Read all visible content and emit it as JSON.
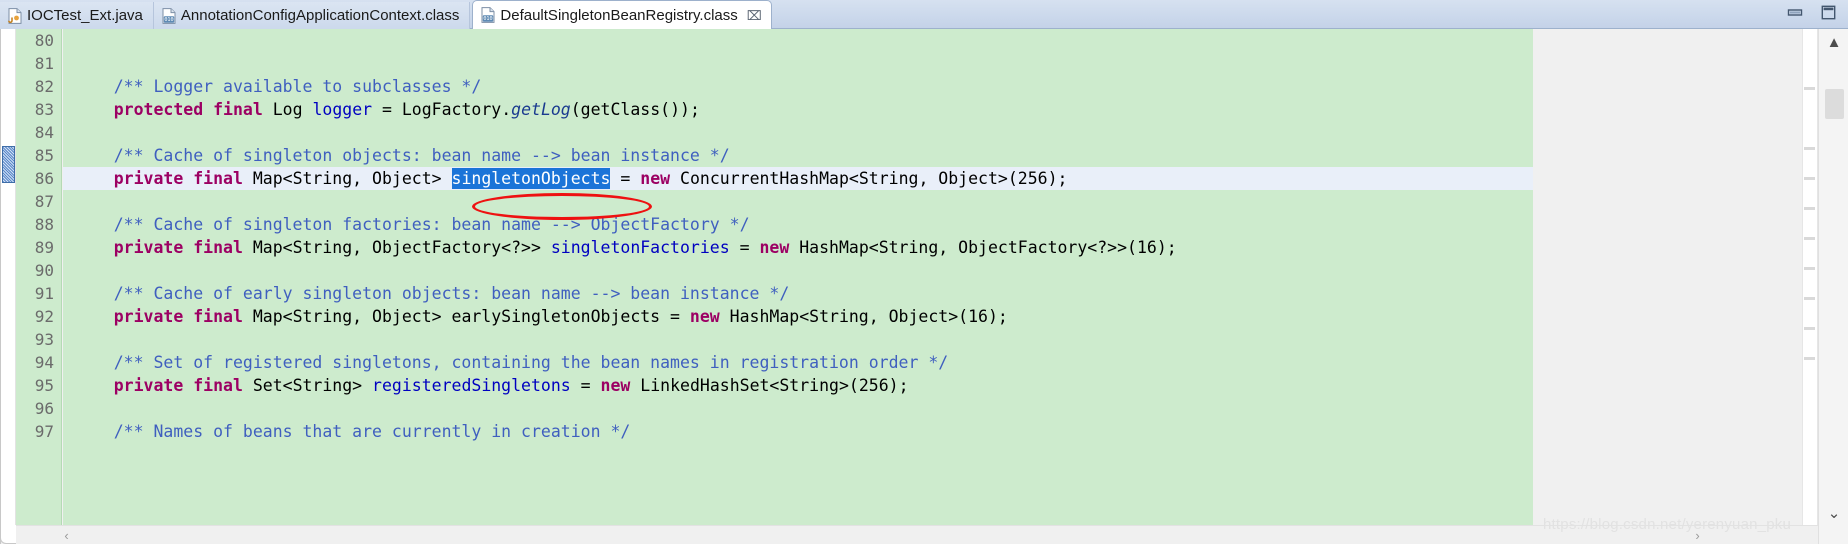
{
  "window": {
    "minimize_label": "Minimize",
    "maximize_label": "Maximize"
  },
  "tabbar": {
    "tabs": [
      {
        "label": "IOCTest_Ext.java",
        "icon": "java-file-icon",
        "active": false,
        "closable": false
      },
      {
        "label": "AnnotationConfigApplicationContext.class",
        "icon": "class-file-icon",
        "active": false,
        "closable": false
      },
      {
        "label": "DefaultSingletonBeanRegistry.class",
        "icon": "class-file-icon",
        "active": true,
        "closable": true,
        "close_glyph": "⌧"
      }
    ]
  },
  "editor": {
    "first_line": 80,
    "current_line": 86,
    "line_numbers": [
      80,
      81,
      82,
      83,
      84,
      85,
      86,
      87,
      88,
      89,
      90,
      91,
      92,
      93,
      94,
      95,
      96,
      97
    ],
    "lines": [
      {
        "n": 80,
        "tokens": []
      },
      {
        "n": 81,
        "tokens": []
      },
      {
        "n": 82,
        "tokens": [
          {
            "t": "    ",
            "c": "t-pln"
          },
          {
            "t": "/** Logger available to subclasses */",
            "c": "t-cmt"
          }
        ]
      },
      {
        "n": 83,
        "tokens": [
          {
            "t": "    ",
            "c": "t-pln"
          },
          {
            "t": "protected final ",
            "c": "t-kw"
          },
          {
            "t": "Log ",
            "c": "t-pln"
          },
          {
            "t": "logger ",
            "c": "t-fld"
          },
          {
            "t": "= LogFactory.",
            "c": "t-pln"
          },
          {
            "t": "getLog",
            "c": "t-mth"
          },
          {
            "t": "(getClass());",
            "c": "t-pln"
          }
        ]
      },
      {
        "n": 84,
        "tokens": []
      },
      {
        "n": 85,
        "tokens": [
          {
            "t": "    ",
            "c": "t-pln"
          },
          {
            "t": "/** Cache of singleton objects: bean name --> bean instance */",
            "c": "t-cmt"
          }
        ]
      },
      {
        "n": 86,
        "current": true,
        "tokens": [
          {
            "t": "    ",
            "c": "t-pln"
          },
          {
            "t": "private final ",
            "c": "t-kw"
          },
          {
            "t": "Map<String, Object> ",
            "c": "t-pln"
          },
          {
            "t": "singletonObjects",
            "c": "sel"
          },
          {
            "t": " = ",
            "c": "t-pln"
          },
          {
            "t": "new ",
            "c": "t-kw"
          },
          {
            "t": "ConcurrentHashMap<String, Object>(256);",
            "c": "t-pln"
          }
        ]
      },
      {
        "n": 87,
        "tokens": []
      },
      {
        "n": 88,
        "tokens": [
          {
            "t": "    ",
            "c": "t-pln"
          },
          {
            "t": "/** Cache of singleton factories: bean name --> ObjectFactory */",
            "c": "t-cmt"
          }
        ]
      },
      {
        "n": 89,
        "tokens": [
          {
            "t": "    ",
            "c": "t-pln"
          },
          {
            "t": "private final ",
            "c": "t-kw"
          },
          {
            "t": "Map<String, ObjectFactory<?>> ",
            "c": "t-pln"
          },
          {
            "t": "singletonFactories ",
            "c": "t-fld"
          },
          {
            "t": "= ",
            "c": "t-pln"
          },
          {
            "t": "new ",
            "c": "t-kw"
          },
          {
            "t": "HashMap<String, ObjectFactory<?>>(16);",
            "c": "t-pln"
          }
        ]
      },
      {
        "n": 90,
        "tokens": []
      },
      {
        "n": 91,
        "tokens": [
          {
            "t": "    ",
            "c": "t-pln"
          },
          {
            "t": "/** Cache of early singleton objects: bean name --> bean instance */",
            "c": "t-cmt"
          }
        ]
      },
      {
        "n": 92,
        "tokens": [
          {
            "t": "    ",
            "c": "t-pln"
          },
          {
            "t": "private final ",
            "c": "t-kw"
          },
          {
            "t": "Map<String, Object> earlySingletonObjects = ",
            "c": "t-pln"
          },
          {
            "t": "new ",
            "c": "t-kw"
          },
          {
            "t": "HashMap<String, Object>(16);",
            "c": "t-pln"
          }
        ]
      },
      {
        "n": 93,
        "tokens": []
      },
      {
        "n": 94,
        "tokens": [
          {
            "t": "    ",
            "c": "t-pln"
          },
          {
            "t": "/** Set of registered singletons, containing the bean names in registration order */",
            "c": "t-cmt"
          }
        ]
      },
      {
        "n": 95,
        "tokens": [
          {
            "t": "    ",
            "c": "t-pln"
          },
          {
            "t": "private final ",
            "c": "t-kw"
          },
          {
            "t": "Set<String> ",
            "c": "t-pln"
          },
          {
            "t": "registeredSingletons ",
            "c": "t-fld"
          },
          {
            "t": "= ",
            "c": "t-pln"
          },
          {
            "t": "new ",
            "c": "t-kw"
          },
          {
            "t": "LinkedHashSet<String>(256);",
            "c": "t-pln"
          }
        ]
      },
      {
        "n": 96,
        "tokens": []
      },
      {
        "n": 97,
        "tokens": [
          {
            "t": "    ",
            "c": "t-pln"
          },
          {
            "t": "/** Names of beans that are currently in creation */",
            "c": "t-cmt"
          }
        ]
      }
    ],
    "annotation": {
      "type": "red-oval",
      "target": "singletonObjects"
    },
    "colors": {
      "code_background": "#cdebcd",
      "current_line": "#e9eff9",
      "comment": "#3f5fbf",
      "keyword": "#9c0063",
      "field": "#0000c0",
      "method": "#1a3a8f",
      "selection": "#1b74d8",
      "annotation": "#ee1111"
    }
  },
  "scrollbars": {
    "up_glyph": "▲",
    "down_glyph": "⌄",
    "left_glyph": "‹",
    "right_glyph": "›"
  },
  "watermark": {
    "text": "https://blog.csdn.net/yerenyuan_pku"
  }
}
